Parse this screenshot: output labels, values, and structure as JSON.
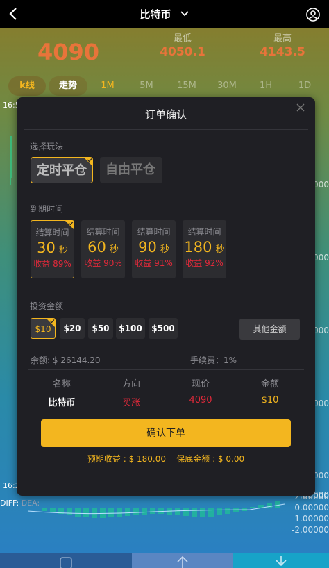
{
  "header": {
    "title": "比特币",
    "back_icon": "chevron-left-icon",
    "menu_icon": "chevron-down-icon",
    "user_icon": "user-circle-icon"
  },
  "price": {
    "current": "4090",
    "low_label": "最低",
    "low_value": "4050.1",
    "high_label": "最高",
    "high_value": "4143.5"
  },
  "tabs": [
    "k线",
    "走势",
    "1M",
    "5M",
    "15M",
    "30M",
    "1H",
    "1D"
  ],
  "chart": {
    "timestamps": [
      "16:5",
      "16:2"
    ],
    "right_axis": [
      ".00000",
      ".00000",
      ".00000",
      ".00000",
      ".00000",
      ".00000",
      "2.00000",
      "0.00000",
      "-1.00000",
      "-2.00000"
    ],
    "diff_label": "DIFF: ",
    "dea_label": "DEA:"
  },
  "modal": {
    "title": "订单确认",
    "play_label": "选择玩法",
    "modes": [
      "定时平仓",
      "自由平仓"
    ],
    "expiry_label": "到期时间",
    "expiry": [
      {
        "label": "结算时间",
        "seconds": "30",
        "unit": "秒",
        "rate": "收益 89%"
      },
      {
        "label": "结算时间",
        "seconds": "60",
        "unit": "秒",
        "rate": "收益 90%"
      },
      {
        "label": "结算时间",
        "seconds": "90",
        "unit": "秒",
        "rate": "收益 91%"
      },
      {
        "label": "结算时间",
        "seconds": "180",
        "unit": "秒",
        "rate": "收益 92%"
      }
    ],
    "amount_label": "投资金额",
    "amounts": [
      "$10",
      "$20",
      "$50",
      "$100",
      "$500"
    ],
    "other_amount": "其他金额",
    "balance": "余额: $ 26144.20",
    "fee": "手续费：1%",
    "table_headers": [
      "名称",
      "方向",
      "现价",
      "金额"
    ],
    "table_row": [
      "比特币",
      "买涨",
      "4090",
      "$10"
    ],
    "confirm": "确认下单",
    "footer": "预期收益 : $ 180.00    保底金额 : $ 0.00"
  },
  "colors": {
    "accent": "#f3b61f",
    "price": "#e8743a",
    "up": "#e0293a"
  }
}
